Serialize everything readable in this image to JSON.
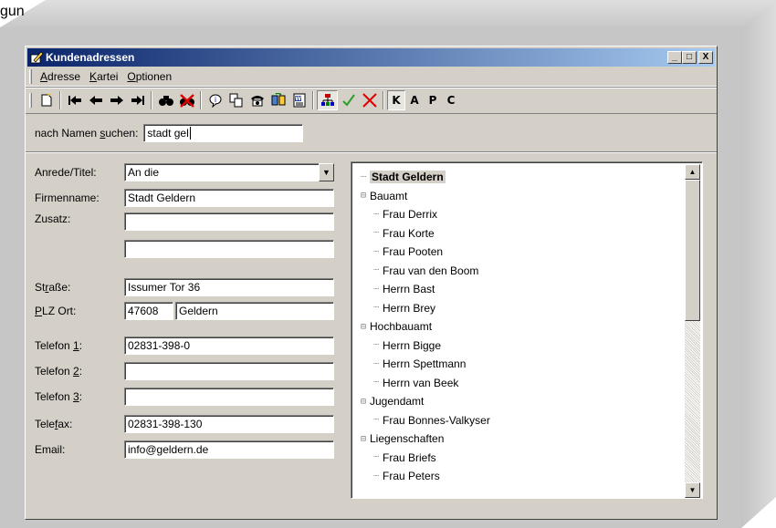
{
  "corner_text": "gun",
  "window": {
    "title": "Kundenadressen",
    "controls": {
      "minimize": "_",
      "maximize": "□",
      "close": "X"
    }
  },
  "menu": [
    {
      "accel": "A",
      "rest": "dresse"
    },
    {
      "accel": "K",
      "rest": "artei"
    },
    {
      "accel": "O",
      "rest": "ptionen"
    }
  ],
  "toolbar": {
    "icons": [
      {
        "name": "new-record-icon",
        "glyph": "🗋"
      },
      {
        "name": "first-record-icon",
        "glyph": "⏮"
      },
      {
        "name": "prev-record-icon",
        "glyph": "⬅"
      },
      {
        "name": "next-record-icon",
        "glyph": "➡"
      },
      {
        "name": "last-record-icon",
        "glyph": "⏭"
      },
      {
        "name": "find-icon",
        "glyph": "🔍"
      },
      {
        "name": "find-clear-icon",
        "glyph": "✖"
      },
      {
        "name": "info-icon",
        "glyph": "💡"
      },
      {
        "name": "copy-icon",
        "glyph": "⧉"
      },
      {
        "name": "phone-icon",
        "glyph": "☎"
      },
      {
        "name": "sync-icon",
        "glyph": "⟳"
      },
      {
        "name": "word-icon",
        "glyph": "🗎"
      },
      {
        "name": "tree-view-icon",
        "glyph": "🖧"
      },
      {
        "name": "confirm-icon",
        "glyph": "✓"
      },
      {
        "name": "cancel-icon",
        "glyph": "✕"
      }
    ],
    "letters": [
      "K",
      "A",
      "P",
      "C"
    ],
    "colors": {
      "confirm": "#2aa02a",
      "cancel": "#e00000",
      "nav": "#000000"
    }
  },
  "search": {
    "label_pre": "nach Namen ",
    "label_accel": "s",
    "label_post": "uchen:",
    "value": "stadt gel"
  },
  "form": {
    "anrede_label": "Anrede/Titel:",
    "anrede_value": "An die",
    "firmenname_label": "Firmenname:",
    "firmenname_value": "Stadt Geldern",
    "zusatz_label": "Zusatz:",
    "zusatz_value": "",
    "zusatz2_value": "",
    "strasse_label_accel": "S",
    "strasse_label_rest": "t",
    "strasse_label_accel2": "r",
    "strasse_label_end": "aße:",
    "strasse_value": "Issumer Tor 36",
    "plz_label_accel": "P",
    "plz_label_rest": "LZ Ort:",
    "plz_value": "47608",
    "ort_value": "Geldern",
    "telefon1_label_pre": "Telefon ",
    "telefon1_label_accel": "1",
    "telefon1_label_post": ":",
    "telefon1_value": "02831-398-0",
    "telefon2_label_pre": "Telefon ",
    "telefon2_label_accel": "2",
    "telefon2_label_post": ":",
    "telefon2_value": "",
    "telefon3_label_pre": "Telefon ",
    "telefon3_label_accel": "3",
    "telefon3_label_post": ":",
    "telefon3_value": "",
    "telefax_label_pre": "Tele",
    "telefax_label_accel": "f",
    "telefax_label_post": "ax:",
    "telefax_value": "02831-398-130",
    "email_label": "Email:",
    "email_value": "info@geldern.de"
  },
  "tree": {
    "root": "Stadt Geldern",
    "departments": [
      {
        "name": "Bauamt",
        "people": [
          "Frau Derrix",
          "Frau Korte",
          "Frau Pooten",
          "Frau van den Boom",
          "Herrn Bast",
          "Herrn Brey"
        ]
      },
      {
        "name": "Hochbauamt",
        "people": [
          "Herrn Bigge",
          "Herrn Spettmann",
          "Herrn van Beek"
        ]
      },
      {
        "name": "Jugendamt",
        "people": [
          "Frau Bonnes-Valkyser"
        ]
      },
      {
        "name": "Liegenschaften",
        "people": [
          "Frau Briefs",
          "Frau Peters"
        ]
      }
    ]
  }
}
